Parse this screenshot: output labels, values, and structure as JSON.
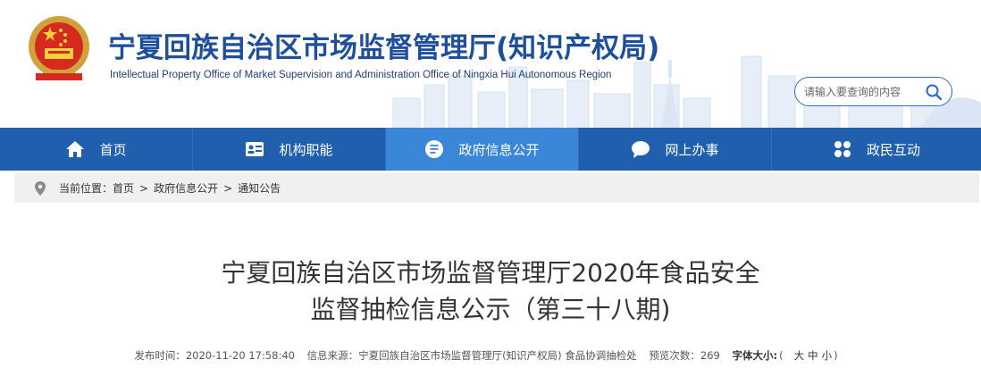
{
  "header": {
    "title": "宁夏回族自治区市场监督管理厅(知识产权局)",
    "subtitle": "Intellectual Property Office of Market Supervision and Administration Office of Ningxia Hui Autonomous Region"
  },
  "search": {
    "placeholder": "请输入要查询的内容"
  },
  "nav": {
    "items": [
      {
        "label": "首页",
        "icon": "home-icon"
      },
      {
        "label": "机构职能",
        "icon": "id-card-icon"
      },
      {
        "label": "政府信息公开",
        "icon": "document-icon"
      },
      {
        "label": "网上办事",
        "icon": "chat-icon"
      },
      {
        "label": "政民互动",
        "icon": "grid-icon"
      }
    ],
    "active": "政府信息公开",
    "bg_color": "#1f5fae",
    "active_color": "#3a86d8"
  },
  "breadcrumb": {
    "prefix": "当前位置：",
    "items": [
      "首页",
      "政府信息公开",
      "通知公告"
    ],
    "separator": ">"
  },
  "article": {
    "title_line1": "宁夏回族自治区市场监督管理厅2020年食品安全",
    "title_line2": "监督抽检信息公示（第三十八期)",
    "publish_time": "发布时间：2020-11-20 17:58:40",
    "source": "信息来源：宁夏回族自治区市场监督管理厅(知识产权局) 食品协调抽检处",
    "views": "预览次数：269",
    "font_size_label": "字体大小:",
    "font_size_open": "(",
    "font_sizes": [
      "大",
      "中",
      "小"
    ],
    "font_size_close": ")"
  }
}
